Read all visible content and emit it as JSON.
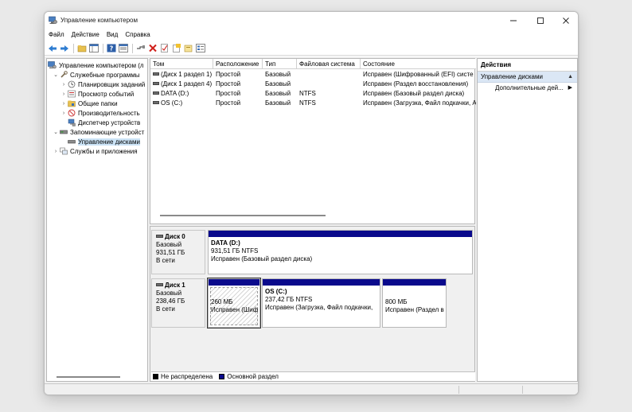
{
  "window": {
    "title": "Управление компьютером",
    "icon": "computer-management-icon"
  },
  "menu": [
    "Файл",
    "Действие",
    "Вид",
    "Справка"
  ],
  "toolbar": {
    "icons": [
      "back-arrow-icon",
      "forward-arrow-icon",
      "up-folder-icon",
      "show-hide-tree-icon",
      "help-icon",
      "properties-icon",
      "connect-icon",
      "delete-icon",
      "check-icon",
      "new-icon",
      "open-icon",
      "list-view-icon"
    ]
  },
  "tree": {
    "items": [
      {
        "label": "Управление компьютером (л",
        "level": 0,
        "expander": "",
        "icon": "computer-icon"
      },
      {
        "label": "Служебные программы",
        "level": 1,
        "expander": "v",
        "icon": "tools-icon"
      },
      {
        "label": "Планировщик заданий",
        "level": 2,
        "expander": ">",
        "icon": "clock-icon"
      },
      {
        "label": "Просмотр событий",
        "level": 2,
        "expander": ">",
        "icon": "event-viewer-icon"
      },
      {
        "label": "Общие папки",
        "level": 2,
        "expander": ">",
        "icon": "shared-folder-icon"
      },
      {
        "label": "Производительность",
        "level": 2,
        "expander": ">",
        "icon": "performance-icon"
      },
      {
        "label": "Диспетчер устройств",
        "level": 2,
        "expander": "",
        "icon": "device-manager-icon"
      },
      {
        "label": "Запоминающие устройст",
        "level": 1,
        "expander": "v",
        "icon": "storage-icon"
      },
      {
        "label": "Управление дисками",
        "level": 2,
        "expander": "",
        "icon": "disk-management-icon",
        "selected": true
      },
      {
        "label": "Службы и приложения",
        "level": 1,
        "expander": ">",
        "icon": "services-icon"
      }
    ]
  },
  "volume_list": {
    "columns": [
      "Том",
      "Расположение",
      "Тип",
      "Файловая система",
      "Состояние"
    ],
    "rows": [
      [
        "(Диск 1 раздел 1)",
        "Простой",
        "Базовый",
        "",
        "Исправен (Шифрованный (EFI) систе"
      ],
      [
        "(Диск 1 раздел 4)",
        "Простой",
        "Базовый",
        "",
        "Исправен (Раздел восстановления)"
      ],
      [
        "DATA (D:)",
        "Простой",
        "Базовый",
        "NTFS",
        "Исправен (Базовый раздел диска)"
      ],
      [
        "OS (C:)",
        "Простой",
        "Базовый",
        "NTFS",
        "Исправен (Загрузка, Файл подкачки, Ав"
      ]
    ]
  },
  "disks": [
    {
      "name": "Диск 0",
      "type": "Базовый",
      "size": "931,51 ГБ",
      "status": "В сети",
      "partitions": [
        {
          "name": "DATA  (D:)",
          "size": "931,51 ГБ NTFS",
          "status": "Исправен (Базовый раздел диска)"
        }
      ]
    },
    {
      "name": "Диск 1",
      "type": "Базовый",
      "size": "238,46 ГБ",
      "status": "В сети",
      "partitions": [
        {
          "name": "",
          "size": "260 МБ",
          "status": "Исправен (Шиф"
        },
        {
          "name": "OS  (C:)",
          "size": "237,42 ГБ NTFS",
          "status": "Исправен (Загрузка, Файл подкачки,"
        },
        {
          "name": "",
          "size": "800 МБ",
          "status": "Исправен (Раздел в"
        }
      ]
    }
  ],
  "legend": [
    {
      "label": "Не распределена",
      "color": "#000000"
    },
    {
      "label": "Основной раздел",
      "color": "#0a0a8c"
    }
  ],
  "actions": {
    "header": "Действия",
    "section": "Управление дисками",
    "items": [
      "Дополнительные дей..."
    ]
  }
}
